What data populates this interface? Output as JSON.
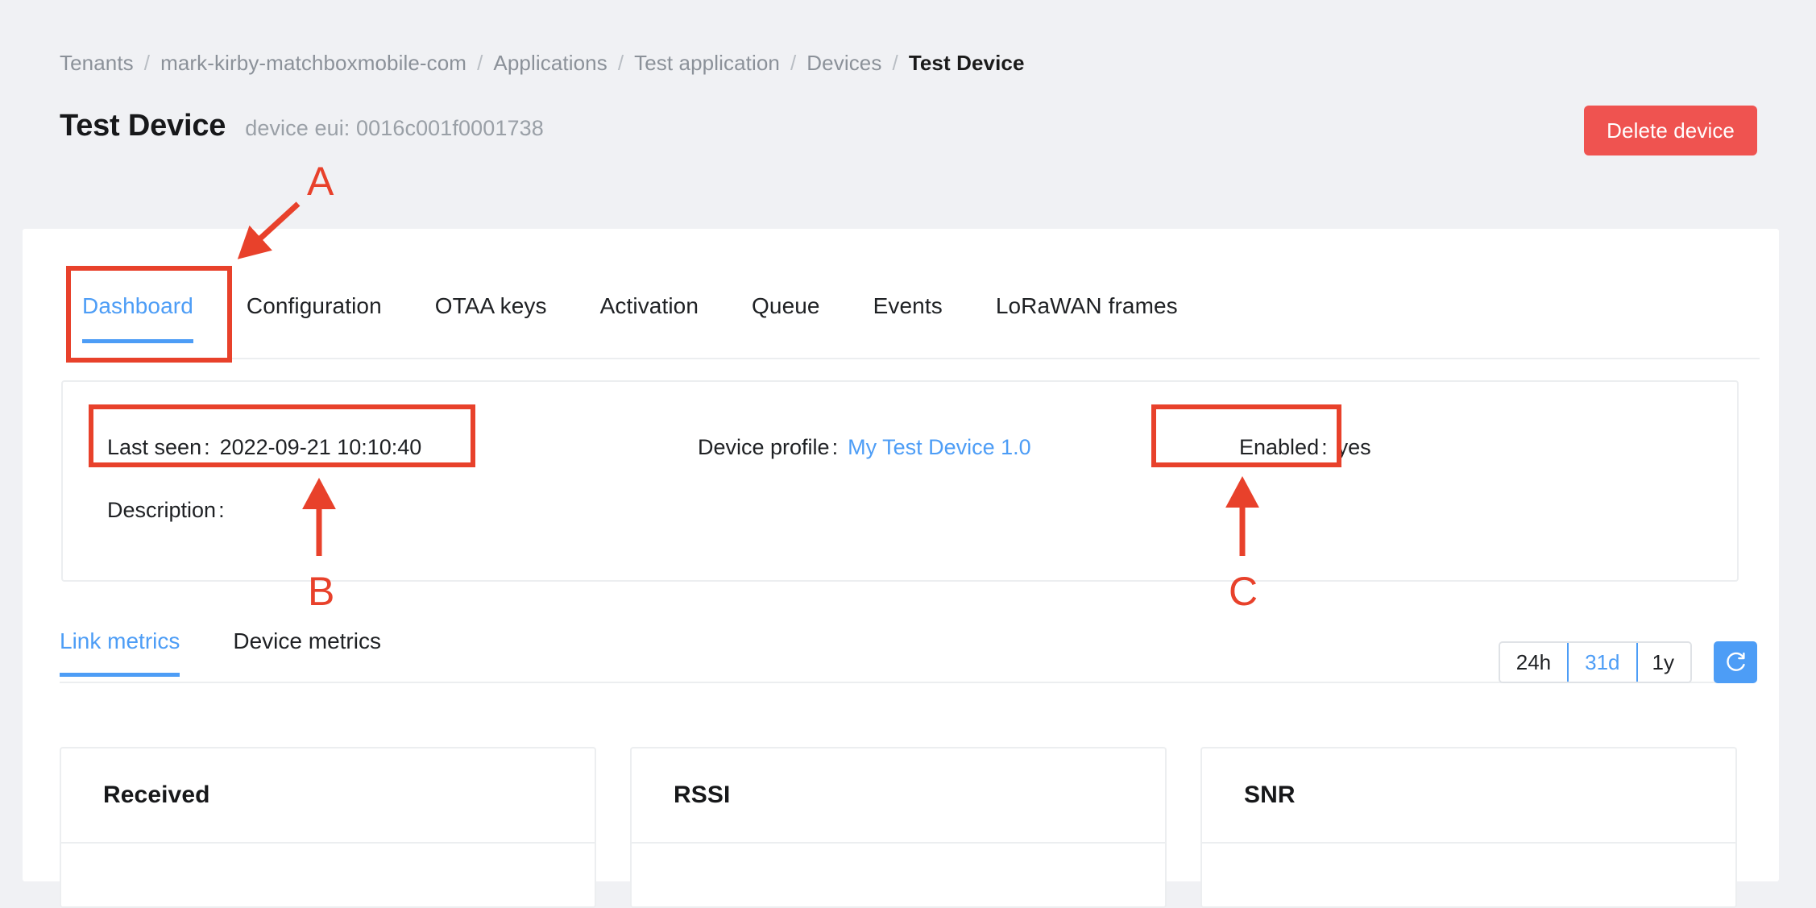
{
  "breadcrumb": {
    "separator": "/",
    "items": [
      {
        "label": "Tenants",
        "current": false
      },
      {
        "label": "mark-kirby-matchboxmobile-com",
        "current": false
      },
      {
        "label": "Applications",
        "current": false
      },
      {
        "label": "Test application",
        "current": false
      },
      {
        "label": "Devices",
        "current": false
      },
      {
        "label": "Test Device",
        "current": true
      }
    ]
  },
  "header": {
    "title": "Test Device",
    "device_eui_label": "device eui: 0016c001f0001738",
    "delete_button": "Delete device"
  },
  "tabs": [
    {
      "label": "Dashboard",
      "active": true
    },
    {
      "label": "Configuration",
      "active": false
    },
    {
      "label": "OTAA keys",
      "active": false
    },
    {
      "label": "Activation",
      "active": false
    },
    {
      "label": "Queue",
      "active": false
    },
    {
      "label": "Events",
      "active": false
    },
    {
      "label": "LoRaWAN frames",
      "active": false
    }
  ],
  "info": {
    "last_seen_label": "Last seen",
    "last_seen_value": "2022-09-21 10:10:40",
    "device_profile_label": "Device profile",
    "device_profile_value": "My Test Device 1.0",
    "enabled_label": "Enabled",
    "enabled_value": "yes",
    "description_label": "Description",
    "description_value": "",
    "colon": ":"
  },
  "metrics": {
    "tabs": [
      {
        "label": "Link metrics",
        "active": true
      },
      {
        "label": "Device metrics",
        "active": false
      }
    ],
    "ranges": [
      {
        "label": "24h",
        "active": false
      },
      {
        "label": "31d",
        "active": true
      },
      {
        "label": "1y",
        "active": false
      }
    ],
    "refresh_icon": "refresh-icon",
    "cards": [
      {
        "title": "Received"
      },
      {
        "title": "RSSI"
      },
      {
        "title": "SNR"
      }
    ]
  },
  "annotations": {
    "color": "#e8412b",
    "letters": [
      {
        "id": "A",
        "label": "A"
      },
      {
        "id": "B",
        "label": "B"
      },
      {
        "id": "C",
        "label": "C"
      }
    ]
  }
}
